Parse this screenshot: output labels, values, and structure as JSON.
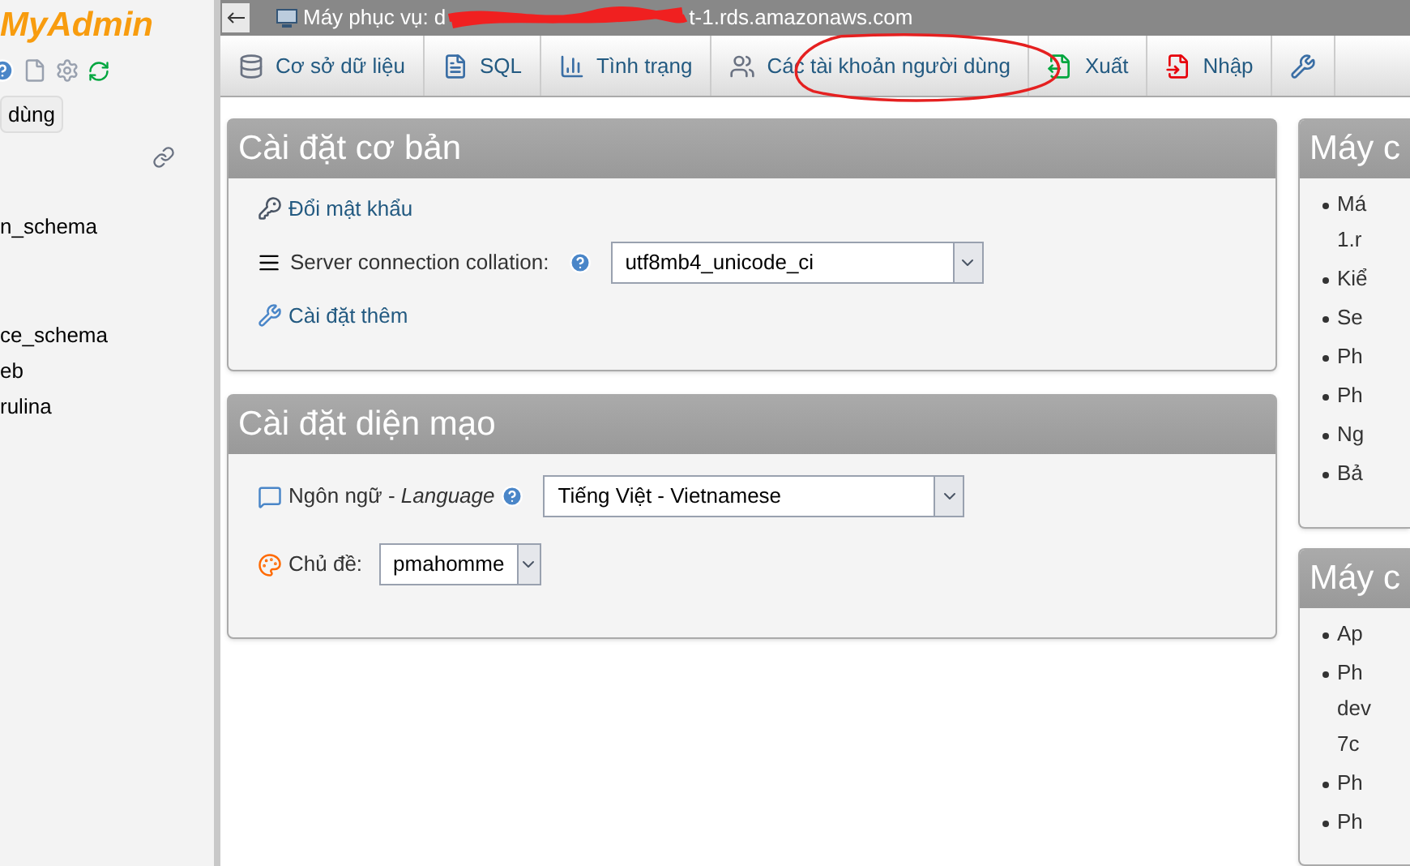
{
  "sidebar": {
    "logo": "MyAdmin",
    "button": "dùng",
    "databases": [
      "n_schema",
      "ce_schema",
      "eb",
      "rulina"
    ]
  },
  "topbar": {
    "server_prefix": "Máy phục vụ: d",
    "server_suffix": "t-1.rds.amazonaws.com"
  },
  "tabs": [
    {
      "label": "Cơ sở dữ liệu",
      "kind": "database"
    },
    {
      "label": "SQL",
      "kind": "sql"
    },
    {
      "label": "Tình trạng",
      "kind": "status"
    },
    {
      "label": "Các tài khoản người dùng",
      "kind": "users"
    },
    {
      "label": "Xuất",
      "kind": "export"
    },
    {
      "label": "Nhập",
      "kind": "import"
    },
    {
      "kind": "settings"
    }
  ],
  "basic_settings": {
    "title": "Cài đặt cơ bản",
    "change_password": "Đổi mật khẩu",
    "collation_label": "Server connection collation:",
    "collation_value": "utf8mb4_unicode_ci",
    "more_settings": "Cài đặt thêm"
  },
  "appearance_settings": {
    "title": "Cài đặt diện mạo",
    "language_label": "Ngôn ngữ - *Language*",
    "language_value": "Tiếng Việt - Vietnamese",
    "theme_label": "Chủ đề:",
    "theme_value": "pmahomme"
  },
  "right_panels": [
    {
      "title": "Máy c",
      "items": [
        [
          "Má",
          "1.r"
        ],
        [
          "Kiể"
        ],
        [
          "Se"
        ],
        [
          "Ph"
        ],
        [
          "Ph"
        ],
        [
          "Ng"
        ],
        [
          "Bả"
        ]
      ]
    },
    {
      "title": "Máy c",
      "items": [
        [
          "Ap"
        ],
        [
          "Ph",
          "dev",
          "7c"
        ],
        [
          "Ph"
        ],
        [
          "Ph"
        ]
      ]
    }
  ]
}
